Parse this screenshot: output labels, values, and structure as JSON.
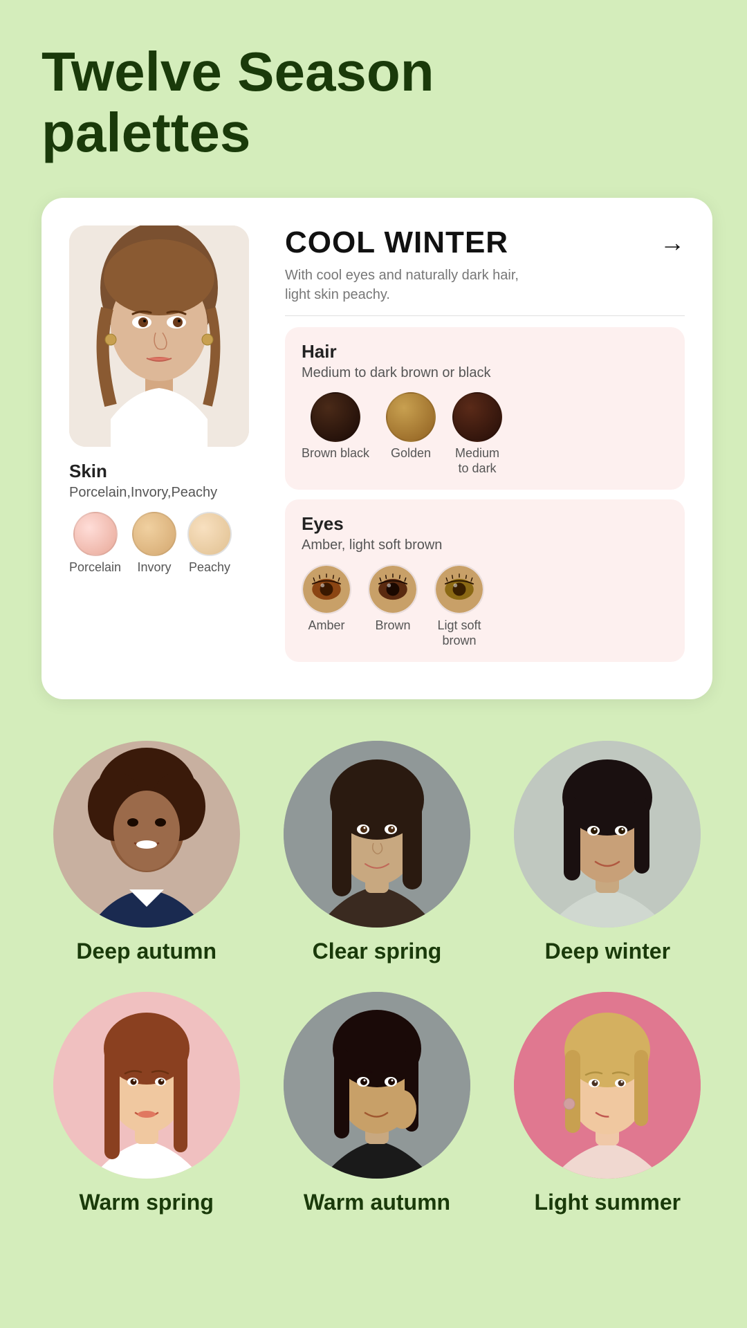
{
  "page": {
    "title": "Twelve Season\npalettes",
    "background_color": "#d4edbb"
  },
  "card": {
    "season_name": "COOL WINTER",
    "season_description": "With cool eyes and naturally dark hair,\nlight skin peachy.",
    "arrow_label": "→",
    "hair": {
      "title": "Hair",
      "subtitle": "Medium to dark brown or black",
      "colors": [
        {
          "label": "Brown black",
          "hex": "#2a1a14"
        },
        {
          "label": "Golden",
          "hex": "#b08840"
        },
        {
          "label": "Medium\nto dark",
          "hex": "#3d1f18"
        }
      ]
    },
    "eyes": {
      "title": "Eyes",
      "subtitle": "Amber, light soft brown",
      "colors": [
        {
          "label": "Amber",
          "hex": "#8b4513",
          "type": "eye"
        },
        {
          "label": "Brown",
          "hex": "#4a2a1a",
          "type": "eye"
        },
        {
          "label": "Ligt soft\nbrown",
          "hex": "#8b6914",
          "type": "eye"
        }
      ]
    },
    "skin": {
      "title": "Skin",
      "subtitle": "Porcelain,Invory,Peachy",
      "tones": [
        {
          "label": "Porcelain",
          "hex": "#f5c8c0"
        },
        {
          "label": "Invory",
          "hex": "#e8c48a"
        },
        {
          "label": "Peachy",
          "hex": "#f0d0a0"
        }
      ]
    }
  },
  "person_grid": [
    {
      "name": "Deep autumn",
      "bg": "#c8b0a0"
    },
    {
      "name": "Clear spring",
      "bg": "#909898"
    },
    {
      "name": "Deep winter",
      "bg": "#b0b8b8"
    },
    {
      "name": "Warm spring",
      "bg": "#f0c0c0"
    },
    {
      "name": "Warm autumn",
      "bg": "#909898"
    },
    {
      "name": "Light summer",
      "bg": "#e07890"
    }
  ]
}
